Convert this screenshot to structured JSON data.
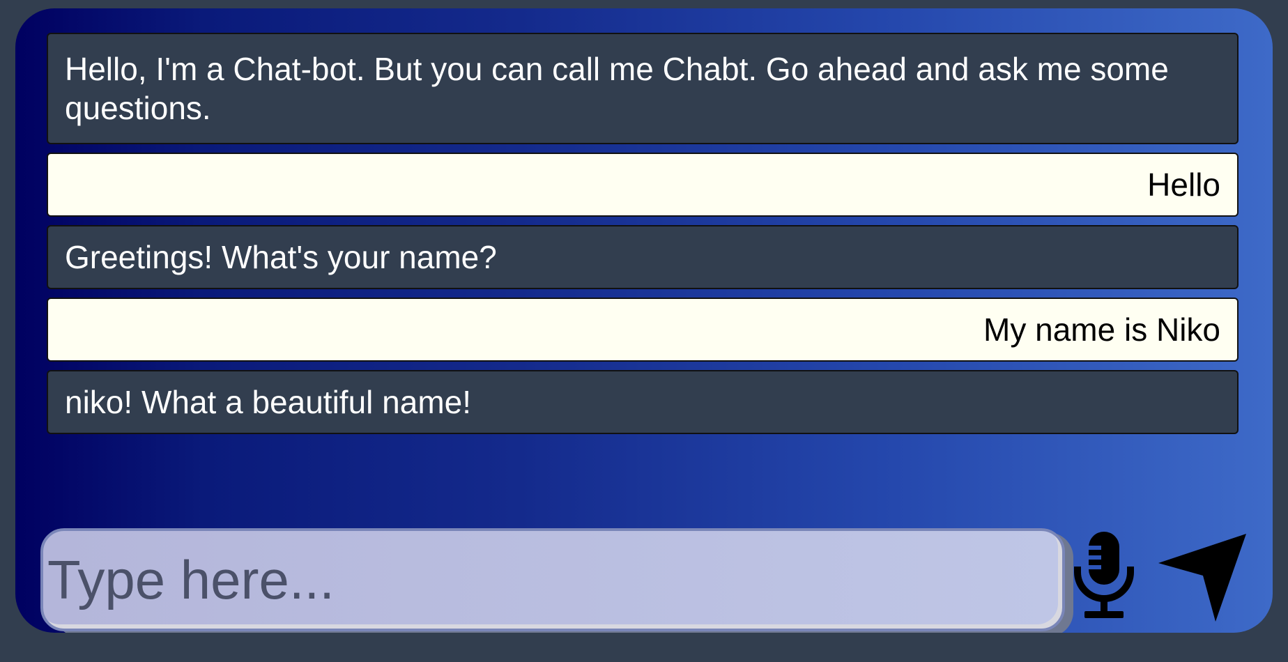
{
  "chat": {
    "messages": [
      {
        "sender": "bot",
        "text": "Hello, I'm a Chat-bot. But you can call me Chabt. Go ahead and ask me some questions."
      },
      {
        "sender": "user",
        "text": "Hello"
      },
      {
        "sender": "bot",
        "text": "Greetings! What's your name?"
      },
      {
        "sender": "user",
        "text": "My name is Niko"
      },
      {
        "sender": "bot",
        "text": "niko! What a beautiful name!"
      }
    ]
  },
  "composer": {
    "placeholder": "Type here...",
    "value": "",
    "mic_icon": "microphone-icon",
    "send_icon": "send-arrow-icon"
  },
  "colors": {
    "page_background": "#323e4f",
    "bot_bubble": "#323e4f",
    "user_bubble": "#fffff2",
    "gradient_start": "#000060",
    "gradient_end": "#3e6ac8"
  }
}
